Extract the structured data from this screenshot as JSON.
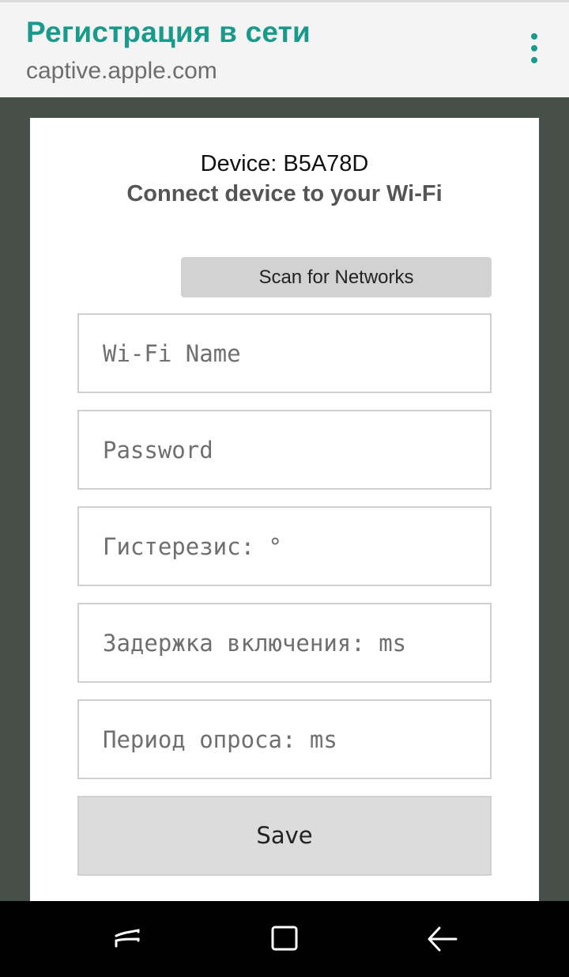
{
  "header": {
    "title": "Регистрация в сети",
    "url": "captive.apple.com",
    "menu_icon": "more-vert-icon",
    "accent_color": "#1a9a8a"
  },
  "page": {
    "device_label": "Device: B5A78D",
    "subtitle": "Connect device to your Wi-Fi",
    "scan_button_label": "Scan for Networks",
    "fields": {
      "wifi_name": {
        "placeholder": "Wi-Fi Name",
        "value": ""
      },
      "password": {
        "placeholder": "Password",
        "value": ""
      },
      "hysteresis": {
        "placeholder": "Гистерезис: °",
        "value": ""
      },
      "on_delay": {
        "placeholder": "Задержка включения: ms",
        "value": ""
      },
      "poll_period": {
        "placeholder": "Период опроса: ms",
        "value": ""
      }
    },
    "save_button_label": "Save"
  },
  "navbar": {
    "recent_icon": "recent-apps-icon",
    "home_icon": "home-icon",
    "back_icon": "back-icon"
  }
}
